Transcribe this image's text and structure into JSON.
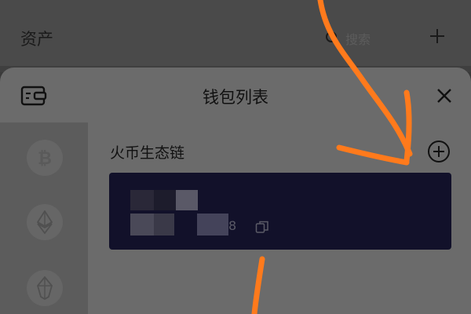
{
  "background": {
    "title": "资产",
    "search_placeholder": "搜索"
  },
  "sheet": {
    "title": "钱包列表"
  },
  "sidebar": {
    "chains": [
      {
        "icon": "bitcoin-icon"
      },
      {
        "icon": "ethereum-icon"
      },
      {
        "icon": "eos-icon"
      }
    ]
  },
  "group": {
    "title": "火币生态链"
  },
  "wallet": {
    "address_suffix": "8"
  },
  "colors": {
    "card": "#12112a",
    "annotation": "#ff7a1c",
    "sheet": "#6b6b6b"
  }
}
